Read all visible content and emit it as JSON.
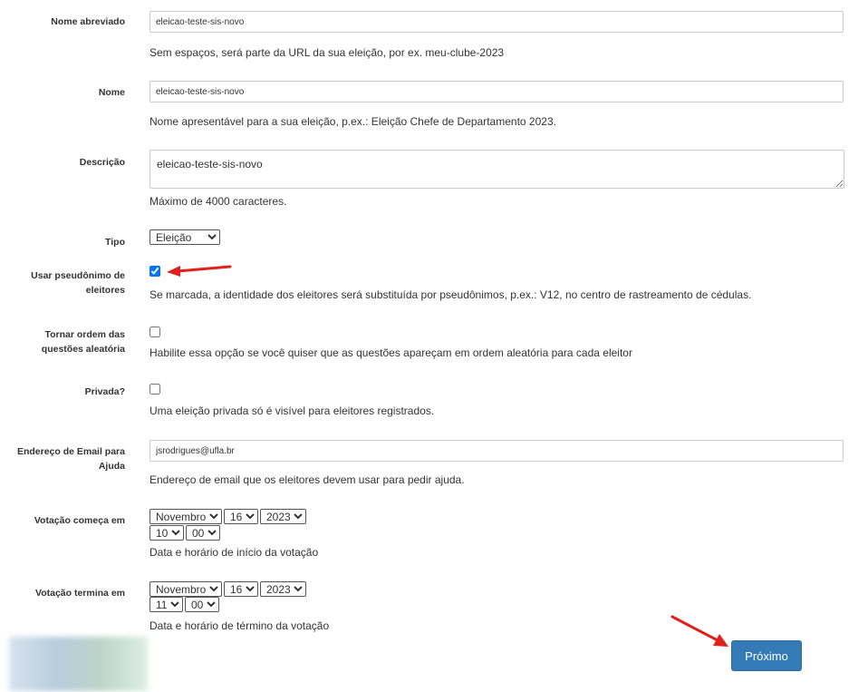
{
  "form": {
    "short_name": {
      "label": "Nome abreviado",
      "value": "eleicao-teste-sis-novo",
      "help": "Sem espaços, será parte da URL da sua eleição, por ex. meu-clube-2023"
    },
    "name": {
      "label": "Nome",
      "value": "eleicao-teste-sis-novo",
      "help": "Nome apresentável para a sua eleição, p.ex.: Eleição Chefe de Departamento 2023."
    },
    "description": {
      "label": "Descrição",
      "value": "eleicao-teste-sis-novo",
      "help": "Máximo de 4000 caracteres."
    },
    "type": {
      "label": "Tipo",
      "selected": "Eleição"
    },
    "pseudonyms": {
      "label_line1": "Usar pseudônimo de",
      "label_line2": "eleitores",
      "checked": true,
      "help": "Se marcada, a identidade dos eleitores será substituída por pseudônimos, p.ex.: V12, no centro de rastreamento de cédulas."
    },
    "random_order": {
      "label_line1": "Tornar ordem das",
      "label_line2": "questões aleatória",
      "checked": false,
      "help": "Habilite essa opção se você quiser que as questões apareçam em ordem aleatória para cada eleitor"
    },
    "private": {
      "label": "Privada?",
      "checked": false,
      "help": "Uma eleição privada só é visível para eleitores registrados."
    },
    "help_email": {
      "label_line1": "Endereço de Email para",
      "label_line2": "Ajuda",
      "value": "jsrodrigues@ufla.br",
      "help": "Endereço de email que os eleitores devem usar para pedir ajuda."
    },
    "voting_start": {
      "label": "Votação começa em",
      "month": "Novembro",
      "day": "16",
      "year": "2023",
      "hour": "10",
      "minute": "00",
      "help": "Data e horário de início da votação"
    },
    "voting_end": {
      "label": "Votação termina em",
      "month": "Novembro",
      "day": "16",
      "year": "2023",
      "hour": "11",
      "minute": "00",
      "help": "Data e horário de término da votação"
    }
  },
  "actions": {
    "next_label": "Próximo"
  },
  "colors": {
    "primary": "#337ab7",
    "annotation_arrow": "#e0201b",
    "checkbox_checked": "#1a73e8"
  }
}
